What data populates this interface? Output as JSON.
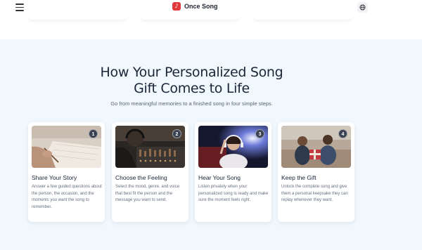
{
  "header": {
    "brand_name": "Once Song",
    "logo_glyph": "♪",
    "icons": {
      "menu": "hamburger-menu-icon",
      "language": "globe-icon"
    }
  },
  "section": {
    "title_line1": "How Your Personalized Song",
    "title_line2": "Gift Comes to Life",
    "subtitle": "Go from meaningful memories to a finished song in four simple steps."
  },
  "steps": [
    {
      "number": "1",
      "title": "Share Your Story",
      "description": "Answer a few guided questions about the person, the occasion, and the moments you want the song to remember."
    },
    {
      "number": "2",
      "title": "Choose the Feeling",
      "description": "Select the mood, genre, and voice that best fit the person and the message you want to send."
    },
    {
      "number": "3",
      "title": "Hear Your Song",
      "description": "Listen privately when your personalized song is ready and make sure the moment feels right."
    },
    {
      "number": "4",
      "title": "Keep the Gift",
      "description": "Unlock the complete song and give them a personal keepsake they can replay whenever they want."
    }
  ],
  "colors": {
    "accent": "#e03a3a",
    "section_bg": "#f0f7fd",
    "heading": "#1a2638",
    "badge": "#3a4150"
  }
}
